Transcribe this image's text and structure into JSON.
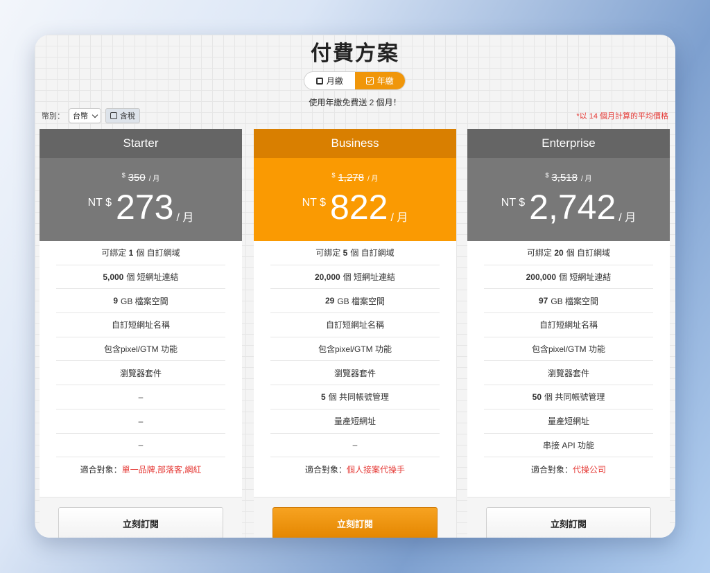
{
  "page_title": "付費方案",
  "billing": {
    "monthly_label": "月繳",
    "annual_label": "年繳",
    "note": "使用年繳免費送 2 個月！"
  },
  "currency": {
    "label": "幣別：",
    "selected": "台幣",
    "tax_label": "含稅"
  },
  "avg_note": "*以 14 個月計算的平均價格",
  "plans": [
    {
      "name": "Starter",
      "orig_symbol": "$",
      "orig_price": "350",
      "orig_unit": "/ 月",
      "currency": "NT $",
      "price": "273",
      "per": "/ 月",
      "features": [
        {
          "num": "1",
          "pre": "可綁定",
          "text": "個 自訂網域"
        },
        {
          "num": "5,000",
          "text": "個 短網址連結"
        },
        {
          "num": "9",
          "text": "GB 檔案空間"
        },
        {
          "text": "自訂短網址名稱"
        },
        {
          "text": "包含pixel/GTM 功能"
        },
        {
          "text": "瀏覽器套件"
        },
        {
          "text": "–"
        },
        {
          "text": "–"
        },
        {
          "text": "–"
        }
      ],
      "audience_label": "適合對象：",
      "audience": "單一品牌,部落客,網紅",
      "cta": "立刻訂閱",
      "color": "#787878"
    },
    {
      "name": "Business",
      "orig_symbol": "$",
      "orig_price": "1,278",
      "orig_unit": "/ 月",
      "currency": "NT $",
      "price": "822",
      "per": "/ 月",
      "features": [
        {
          "num": "5",
          "pre": "可綁定",
          "text": "個 自訂網域"
        },
        {
          "num": "20,000",
          "text": "個 短網址連結"
        },
        {
          "num": "29",
          "text": "GB 檔案空間"
        },
        {
          "text": "自訂短網址名稱"
        },
        {
          "text": "包含pixel/GTM 功能"
        },
        {
          "text": "瀏覽器套件"
        },
        {
          "num": "5",
          "text": "個 共同帳號管理"
        },
        {
          "text": "量產短網址"
        },
        {
          "text": "–"
        }
      ],
      "audience_label": "適合對象：",
      "audience": "個人接案代操手",
      "cta": "立刻訂閱",
      "color": "#fa9a02"
    },
    {
      "name": "Enterprise",
      "orig_symbol": "$",
      "orig_price": "3,518",
      "orig_unit": "/ 月",
      "currency": "NT $",
      "price": "2,742",
      "per": "/ 月",
      "features": [
        {
          "num": "20",
          "pre": "可綁定",
          "text": "個 自訂網域"
        },
        {
          "num": "200,000",
          "text": "個 短網址連結"
        },
        {
          "num": "97",
          "text": "GB 檔案空間"
        },
        {
          "text": "自訂短網址名稱"
        },
        {
          "text": "包含pixel/GTM 功能"
        },
        {
          "text": "瀏覽器套件"
        },
        {
          "num": "50",
          "text": "個 共同帳號管理"
        },
        {
          "text": "量產短網址"
        },
        {
          "text": "串接 API 功能"
        }
      ],
      "audience_label": "適合對象：",
      "audience": "代操公司",
      "cta": "立刻訂閱",
      "color": "#787878"
    }
  ]
}
